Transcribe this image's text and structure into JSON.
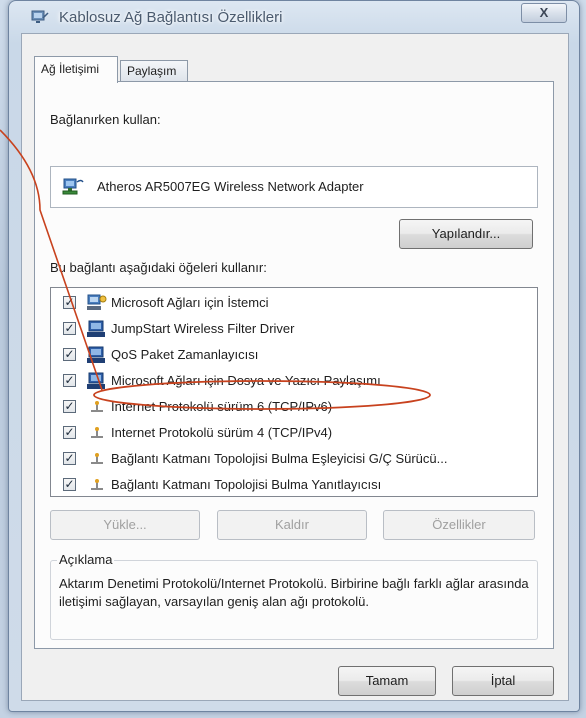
{
  "window": {
    "title": "Kablosuz Ağ Bağlantısı Özellikleri",
    "close_label": "X"
  },
  "tabs": [
    {
      "label": "Ağ İletişimi",
      "active": true
    },
    {
      "label": "Paylaşım",
      "active": false
    }
  ],
  "connect_using": {
    "label": "Bağlanırken kullan:",
    "adapter_name": "Atheros AR5007EG Wireless Network Adapter",
    "configure_label": "Yapılandır..."
  },
  "items": {
    "label": "Bu bağlantı aşağıdaki öğeleri kullanır:",
    "list": [
      {
        "label": "Microsoft Ağları için İstemci",
        "checked": true,
        "icon": "network-client-icon"
      },
      {
        "label": "JumpStart Wireless Filter Driver",
        "checked": true,
        "icon": "network-service-icon"
      },
      {
        "label": "QoS Paket Zamanlayıcısı",
        "checked": true,
        "icon": "network-service-icon"
      },
      {
        "label": "Microsoft Ağları için Dosya ve Yazıcı Paylaşımı",
        "checked": true,
        "icon": "network-service-icon"
      },
      {
        "label": "Internet Protokolü sürüm 6 (TCP/IPv6)",
        "checked": true,
        "icon": "protocol-icon"
      },
      {
        "label": "Internet Protokolü sürüm 4 (TCP/IPv4)",
        "checked": true,
        "icon": "protocol-icon",
        "highlighted": true
      },
      {
        "label": "Bağlantı Katmanı Topolojisi Bulma Eşleyicisi G/Ç Sürücü...",
        "checked": true,
        "icon": "protocol-icon"
      },
      {
        "label": "Bağlantı Katmanı Topolojisi Bulma Yanıtlayıcısı",
        "checked": true,
        "icon": "protocol-icon"
      }
    ]
  },
  "actions": {
    "install_label": "Yükle...",
    "uninstall_label": "Kaldır",
    "properties_label": "Özellikler"
  },
  "description": {
    "legend": "Açıklama",
    "text": "Aktarım Denetimi Protokolü/Internet Protokolü. Birbirine bağlı farklı ağlar arasında iletişimi sağlayan, varsayılan geniş alan ağı protokolü."
  },
  "footer": {
    "ok_label": "Tamam",
    "cancel_label": "İptal"
  },
  "colors": {
    "annotation": "#c8421e",
    "checkmark": "#1c2a3a"
  }
}
